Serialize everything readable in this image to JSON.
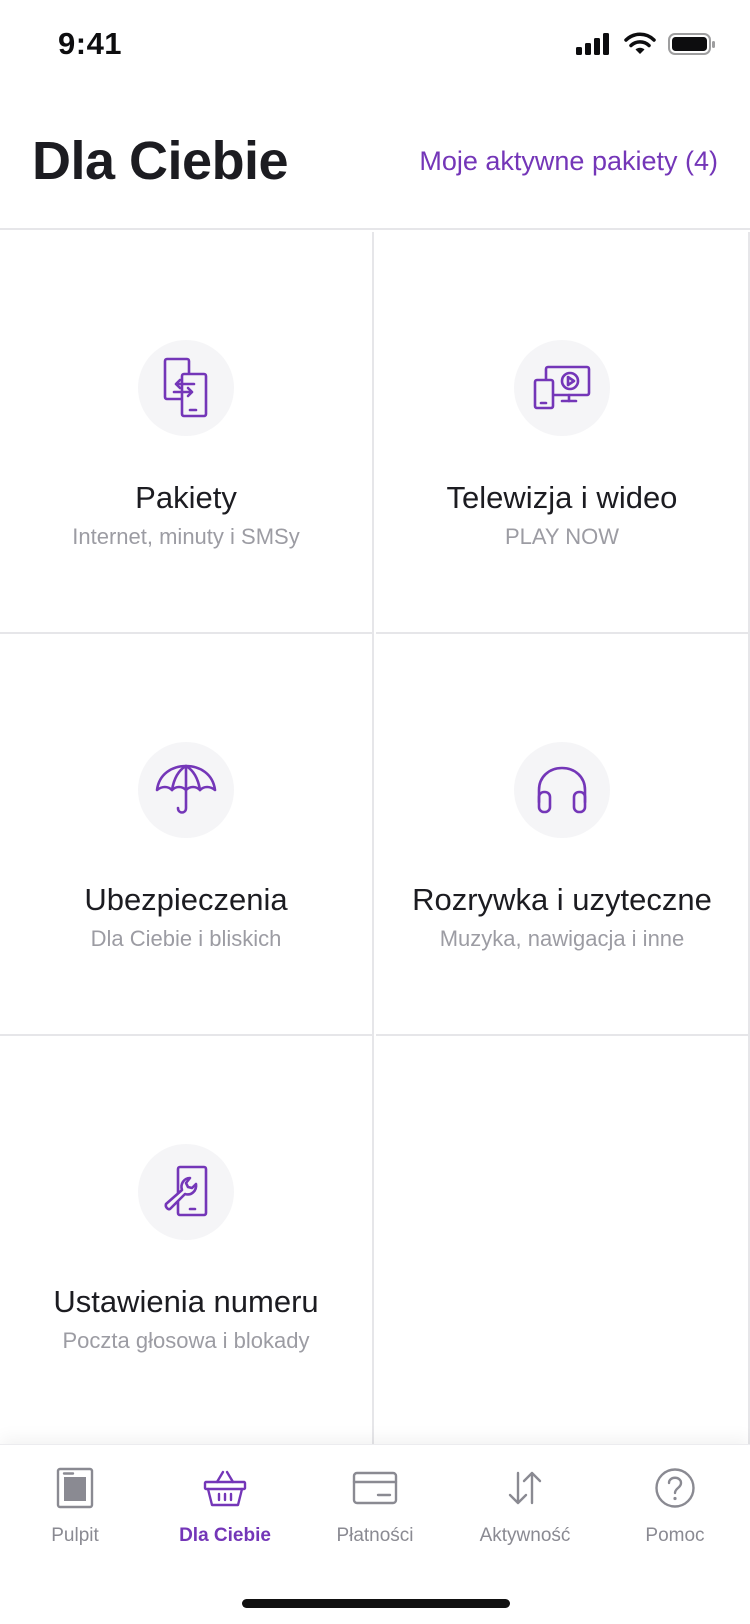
{
  "status_bar": {
    "time": "9:41"
  },
  "header": {
    "title": "Dla Ciebie",
    "active_packs_link": "Moje aktywne pakiety (4)"
  },
  "tiles": [
    {
      "title": "Pakiety",
      "subtitle": "Internet, minuty i SMSy",
      "icon": "phone-transfer-icon"
    },
    {
      "title": "Telewizja i wideo",
      "subtitle": "PLAY NOW",
      "icon": "tv-devices-icon"
    },
    {
      "title": "Ubezpieczenia",
      "subtitle": "Dla Ciebie i bliskich",
      "icon": "umbrella-icon"
    },
    {
      "title": "Rozrywka i uzyteczne",
      "subtitle": "Muzyka, nawigacja i inne",
      "icon": "headphones-icon"
    },
    {
      "title": "Ustawienia numeru",
      "subtitle": "Poczta głosowa i blokady",
      "icon": "phone-wrench-icon"
    }
  ],
  "tabbar": {
    "active_index": 1,
    "items": [
      {
        "label": "Pulpit",
        "icon": "dashboard-icon"
      },
      {
        "label": "Dla Ciebie",
        "icon": "basket-icon"
      },
      {
        "label": "Płatności",
        "icon": "card-icon"
      },
      {
        "label": "Aktywność",
        "icon": "arrows-icon"
      },
      {
        "label": "Pomoc",
        "icon": "help-icon"
      }
    ]
  },
  "colors": {
    "accent": "#7436b8",
    "text": "#1c1c21",
    "muted": "#9c9ca3",
    "divider": "#e6e6e9",
    "icon_bg": "#f5f5f7",
    "tab_inactive": "#8a8a92"
  }
}
